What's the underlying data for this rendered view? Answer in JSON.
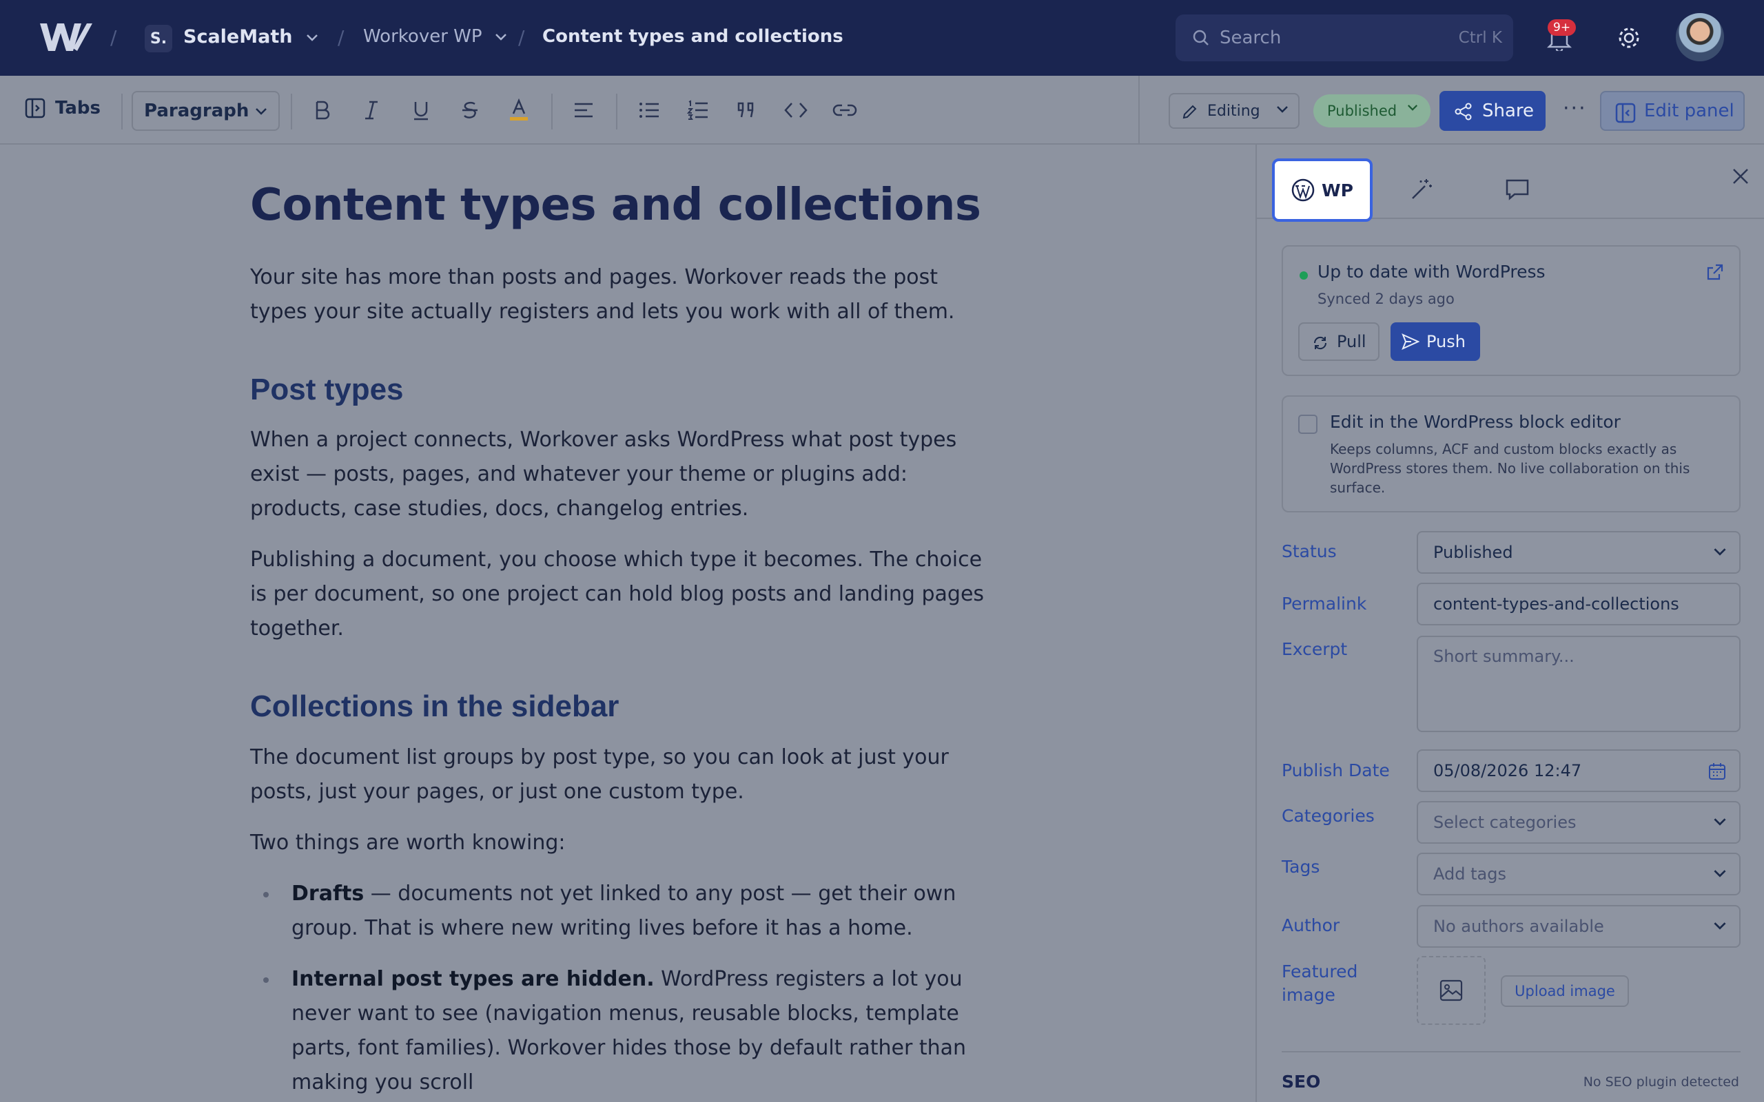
{
  "topbar": {
    "workspace_initial": "S.",
    "workspace_name": "ScaleMath",
    "project_name": "Workover WP",
    "current_doc": "Content types and collections",
    "search_placeholder": "Search",
    "search_shortcut": "Ctrl K",
    "notification_badge": "9+"
  },
  "toolbar": {
    "tabs_label": "Tabs",
    "block_type": "Paragraph",
    "mode_label": "Editing",
    "status_pill": "Published",
    "share_label": "Share",
    "more_label": "···",
    "edit_panel_label": "Edit panel"
  },
  "document": {
    "title": "Content types and collections",
    "intro": "Your site has more than posts and pages. Workover reads the post types your site actually registers and lets you work with all of them.",
    "h2_post_types": "Post types",
    "p_post_types_1": "When a project connects, Workover asks WordPress what post types exist — posts, pages, and whatever your theme or plugins add: products, case studies, docs, changelog entries.",
    "p_post_types_2": "Publishing a document, you choose which type it becomes. The choice is per document, so one project can hold blog posts and landing pages together.",
    "h2_collections": "Collections in the sidebar",
    "p_collections_1": "The document list groups by post type, so you can look at just your posts, just your pages, or just one custom type.",
    "p_collections_2": "Two things are worth knowing:",
    "bullets": [
      {
        "bold": "Drafts",
        "text": " — documents not yet linked to any post — get their own group. That is where new writing lives before it has a home."
      },
      {
        "bold": "Internal post types are hidden.",
        "text": " WordPress registers a lot you never want to see (navigation menus, reusable blocks, template parts, font families). Workover hides those by default rather than making you scroll"
      }
    ]
  },
  "panel": {
    "tab_wp_label": "WP",
    "sync_status": "Up to date with WordPress",
    "sync_time": "Synced 2 days ago",
    "pull_label": "Pull",
    "push_label": "Push",
    "block_editor_label": "Edit in the WordPress block editor",
    "block_editor_desc": "Keeps columns, ACF and custom blocks exactly as WordPress stores them. No live collaboration on this surface.",
    "fields": {
      "status_label": "Status",
      "status_value": "Published",
      "permalink_label": "Permalink",
      "permalink_value": "content-types-and-collections",
      "excerpt_label": "Excerpt",
      "excerpt_placeholder": "Short summary...",
      "publish_date_label": "Publish Date",
      "publish_date_value": "05/08/2026 12:47",
      "categories_label": "Categories",
      "categories_placeholder": "Select categories",
      "tags_label": "Tags",
      "tags_placeholder": "Add tags",
      "author_label": "Author",
      "author_value": "No authors available",
      "featured_label": "Featured image",
      "upload_label": "Upload image"
    },
    "seo_label": "SEO",
    "seo_note": "No SEO plugin detected"
  },
  "colors": {
    "topbar_bg": "#1a2550",
    "accent": "#2b4aa3",
    "published_green": "#1e9e57",
    "badge_red": "#d62f3d"
  },
  "icons": [
    "logo-icon",
    "chevron-down-icon",
    "search-icon",
    "bell-icon",
    "gear-icon",
    "panel-icon",
    "bold-icon",
    "italic-icon",
    "underline-icon",
    "strikethrough-icon",
    "text-color-icon",
    "align-icon",
    "bullet-list-icon",
    "numbered-list-icon",
    "quote-icon",
    "code-icon",
    "link-icon",
    "pencil-icon",
    "share-icon",
    "edit-panel-icon",
    "wordpress-icon",
    "magic-wand-icon",
    "comment-icon",
    "close-icon",
    "external-link-icon",
    "refresh-icon",
    "send-icon",
    "calendar-icon",
    "image-icon"
  ]
}
